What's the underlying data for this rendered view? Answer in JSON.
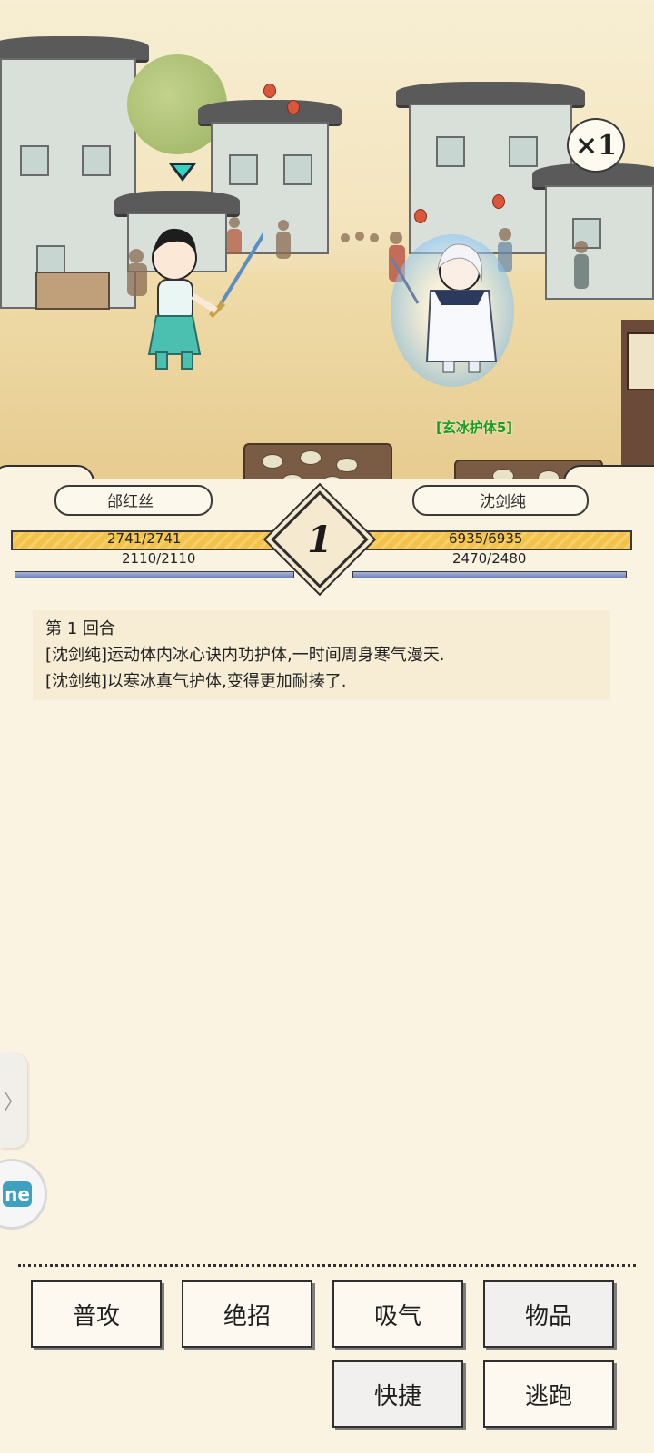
{
  "scene": {
    "speed_label": "×1",
    "buff_label": "[玄冰护体5]"
  },
  "player": {
    "name": "邰红丝",
    "hp": "2741/2741",
    "mp": "2110/2110"
  },
  "enemy": {
    "name": "沈剑纯",
    "hp": "6935/6935",
    "mp": "2470/2480"
  },
  "round": {
    "number": "1"
  },
  "log": {
    "lines": [
      "第 1 回合",
      "[沈剑纯]运动体内冰心诀内功护体,一时间周身寒气漫天.",
      "[沈剑纯]以寒冰真气护体,变得更加耐揍了."
    ]
  },
  "side": {
    "tab_glyph": "〉",
    "app_icon": "ne"
  },
  "actions": {
    "attack": "普攻",
    "ultimate": "绝招",
    "absorb": "吸气",
    "items": "物品",
    "quick": "快捷",
    "flee": "逃跑"
  },
  "colors": {
    "hp_bar": "#f3c24a",
    "mp_bar": "#6f82bd",
    "buff_text": "#1d9a1d",
    "shield": "#5fb0f0"
  }
}
